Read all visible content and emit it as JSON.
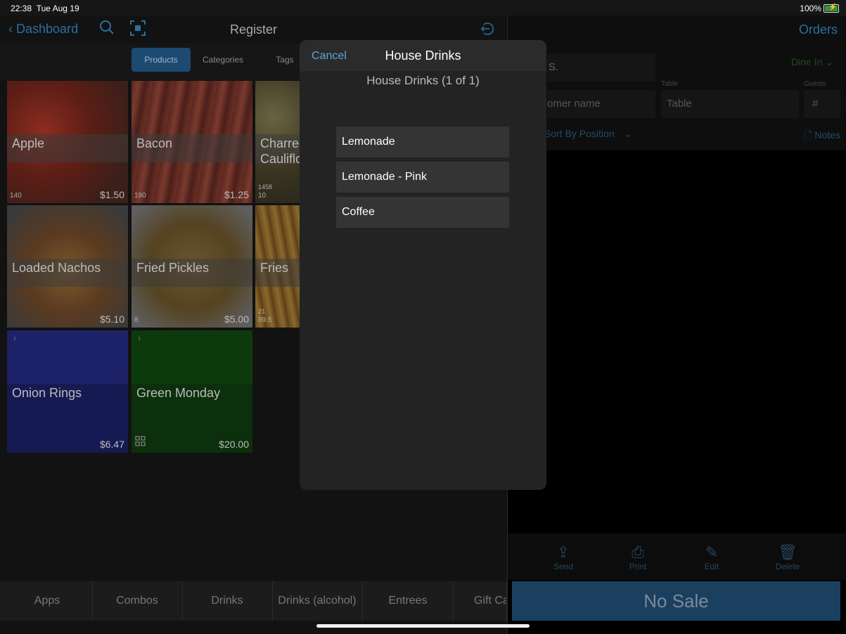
{
  "status": {
    "time": "22:38",
    "date": "Tue Aug 19",
    "battery": "100%"
  },
  "nav": {
    "back_label": "Dashboard",
    "title": "Register",
    "orders_label": "Orders"
  },
  "segments": [
    "Products",
    "Categories",
    "Tags"
  ],
  "products": [
    {
      "name": "Apple",
      "count": "140",
      "price": "$1.50",
      "bg": "#4a2b22"
    },
    {
      "name": "Bacon",
      "count": "190",
      "price": "$1.25",
      "bg": "#4b2a26"
    },
    {
      "name": "Charred Cauliflo",
      "count_top": "1458",
      "count": "10",
      "price": "",
      "bg": "#3e3a2a"
    },
    {
      "name": "Loaded Nachos",
      "count": "",
      "price": "$5.10",
      "bg": "#4a3a28"
    },
    {
      "name": "Fried Pickles",
      "count": "8",
      "price": "$5.00",
      "bg": "#4a3f2c"
    },
    {
      "name": "Fries",
      "count_top": "21",
      "count": "89.5",
      "price": "",
      "bg": "#4a3a24"
    },
    {
      "name": "Onion Rings",
      "count": "",
      "price": "$6.47",
      "bg": "#1d2070",
      "info": "i"
    },
    {
      "name": "Green Monday",
      "count": "",
      "price": "$20.00",
      "bg": "#0c3a0c",
      "info": "i"
    }
  ],
  "bottom_tabs": [
    "Apps",
    "Combos",
    "Drinks",
    "Drinks (alcohol)",
    "Entrees",
    "Gift Ca"
  ],
  "right": {
    "dine_in": "Dine In",
    "server_value": "S.",
    "customer_placeholder": "omer name",
    "table_label": "Table",
    "table_placeholder": "Table",
    "guests_label": "Guests",
    "guests_placeholder": "#",
    "sort_label": "Sort By Position",
    "notes_label": "Notes",
    "actions": [
      "Send",
      "Print",
      "Edit",
      "Delete"
    ],
    "no_sale": "No Sale"
  },
  "modal": {
    "cancel": "Cancel",
    "title": "House Drinks",
    "subtitle": "House Drinks (1 of 1)",
    "options": [
      "Lemonade",
      "Lemonade - Pink",
      "Coffee"
    ]
  }
}
